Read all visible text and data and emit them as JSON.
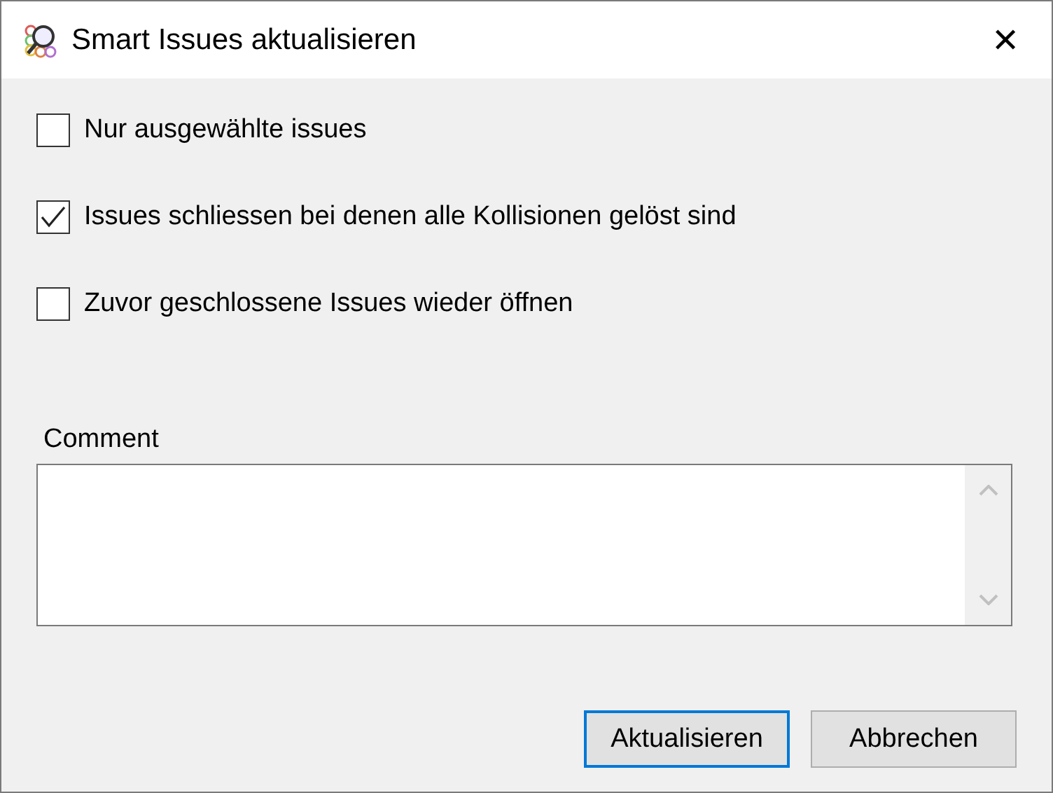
{
  "window": {
    "title": "Smart Issues aktualisieren",
    "close": "✕"
  },
  "options": [
    {
      "label": "Nur ausgewählte issues",
      "checked": false
    },
    {
      "label": "Issues schliessen bei denen alle Kollisionen gelöst sind",
      "checked": true
    },
    {
      "label": "Zuvor geschlossene Issues wieder öffnen",
      "checked": false
    }
  ],
  "comment": {
    "label": "Comment"
  },
  "buttons": [
    {
      "label": "Aktualisieren",
      "selected": true
    },
    {
      "label": "Abbrechen",
      "selected": false
    }
  ]
}
